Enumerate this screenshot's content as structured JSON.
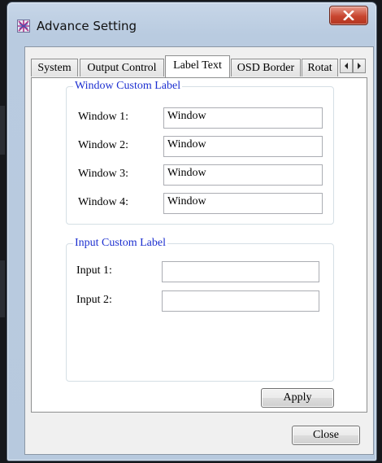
{
  "window": {
    "title": "Advance Setting",
    "close_glyph": "X"
  },
  "tabs": [
    {
      "label": "System",
      "active": false
    },
    {
      "label": "Output Control",
      "active": false
    },
    {
      "label": "Label Text",
      "active": true
    },
    {
      "label": "OSD Border",
      "active": false
    },
    {
      "label": "Rotat",
      "active": false
    }
  ],
  "tab_scroll": {
    "left_icon": "chevron-left-icon",
    "right_icon": "chevron-right-icon"
  },
  "window_group": {
    "title": "Window Custom Label",
    "rows": [
      {
        "label": "Window 1:",
        "value": "Window"
      },
      {
        "label": "Window 2:",
        "value": "Window"
      },
      {
        "label": "Window 3:",
        "value": "Window"
      },
      {
        "label": "Window 4:",
        "value": "Window"
      }
    ]
  },
  "input_group": {
    "title": "Input Custom Label",
    "rows": [
      {
        "label": "Input 1:",
        "value": ""
      },
      {
        "label": "Input 2:",
        "value": ""
      }
    ]
  },
  "buttons": {
    "apply": "Apply",
    "close": "Close"
  },
  "colors": {
    "group_title": "#1c2fd0",
    "close_button": "#c8452f"
  }
}
